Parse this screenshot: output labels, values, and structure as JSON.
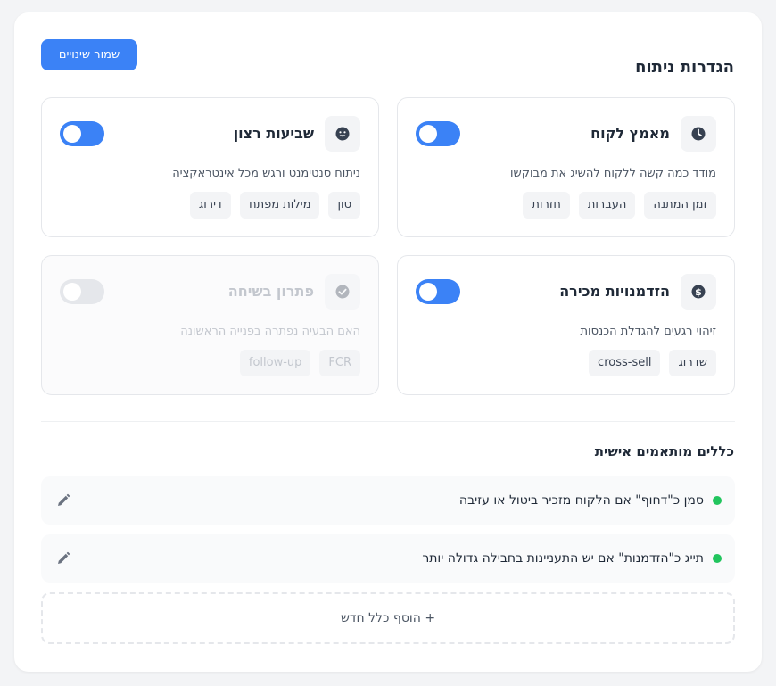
{
  "header": {
    "title": "הגדרות ניתוח",
    "save_label": "שמור שינויים"
  },
  "colors": {
    "accent": "#3b82f6",
    "active_dot": "#22c55e"
  },
  "cards": [
    {
      "title": "מאמץ לקוח",
      "icon": "clock-icon",
      "enabled": true,
      "description": "מודד כמה קשה ללקוח להשיג את מבוקשו",
      "tags": [
        "זמן המתנה",
        "העברות",
        "חזרות"
      ]
    },
    {
      "title": "שביעות רצון",
      "icon": "smiley-icon",
      "enabled": true,
      "description": "ניתוח סנטימנט ורגש מכל אינטראקציה",
      "tags": [
        "טון",
        "מילות מפתח",
        "דירוג"
      ]
    },
    {
      "title": "הזדמנויות מכירה",
      "icon": "dollar-icon",
      "enabled": true,
      "description": "זיהוי רגעים להגדלת הכנסות",
      "tags": [
        "שדרוג",
        "cross-sell"
      ]
    },
    {
      "title": "פתרון בשיחה",
      "icon": "check-circle-icon",
      "enabled": false,
      "description": "האם הבעיה נפתרה בפנייה הראשונה",
      "tags": [
        "FCR",
        "follow-up"
      ]
    }
  ],
  "custom_rules": {
    "title": "כללים מותאמים אישית",
    "rules": [
      "סמן כ\"דחוף\" אם הלקוח מזכיר ביטול או עזיבה",
      "תייג כ\"הזדמנות\" אם יש התעניינות בחבילה גדולה יותר"
    ],
    "add_label": "+ הוסף כלל חדש"
  }
}
